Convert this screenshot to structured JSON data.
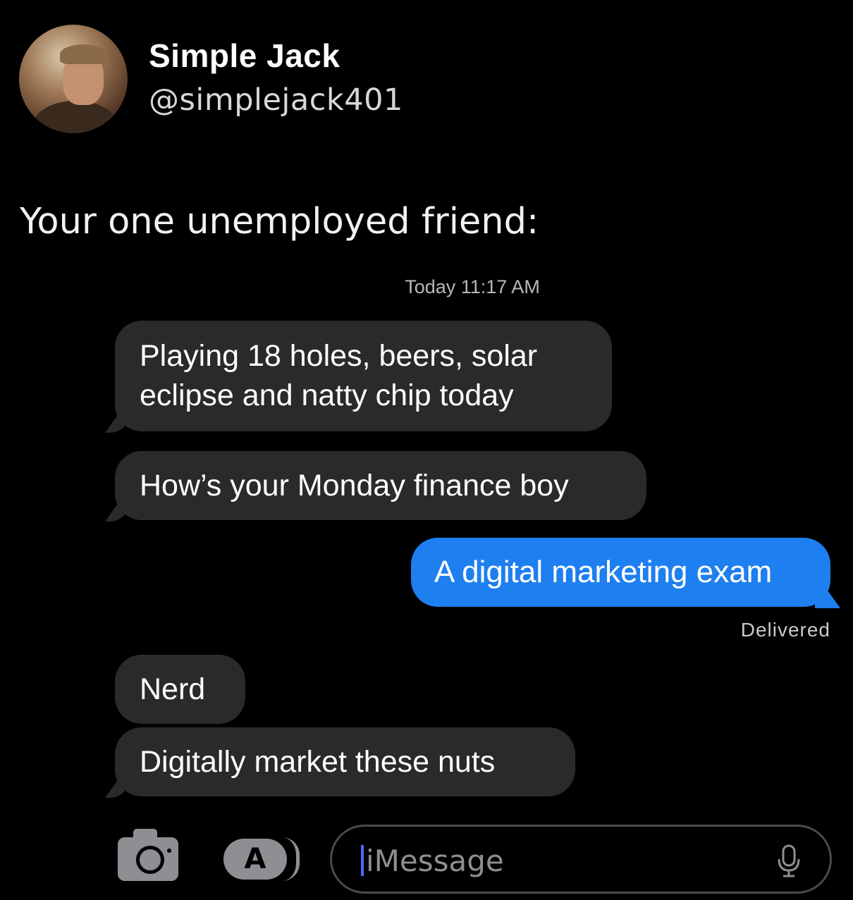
{
  "profile": {
    "name": "Simple Jack",
    "handle": "@simplejack401"
  },
  "tweet": {
    "text": "Your one unemployed friend:"
  },
  "conversation": {
    "timestamp": "Today 11:17 AM",
    "messages": [
      {
        "direction": "incoming",
        "line1": "Playing 18 holes, beers, solar",
        "line2": "eclipse and natty chip today"
      },
      {
        "direction": "incoming",
        "text": "How’s your Monday finance boy"
      },
      {
        "direction": "outgoing",
        "text": "A digital marketing exam"
      },
      {
        "direction": "incoming",
        "text": "Nerd"
      },
      {
        "direction": "incoming",
        "text": "Digitally market these nuts"
      }
    ],
    "delivered_label": "Delivered"
  },
  "composer": {
    "placeholder": "iMessage",
    "icons": [
      "camera-icon",
      "app-store-icon",
      "microphone-icon"
    ]
  },
  "colors": {
    "background": "#000000",
    "incoming_bubble": "#2a2a2d",
    "outgoing_bubble": "#1e7ff0",
    "secondary_text": "#8e8e93"
  }
}
